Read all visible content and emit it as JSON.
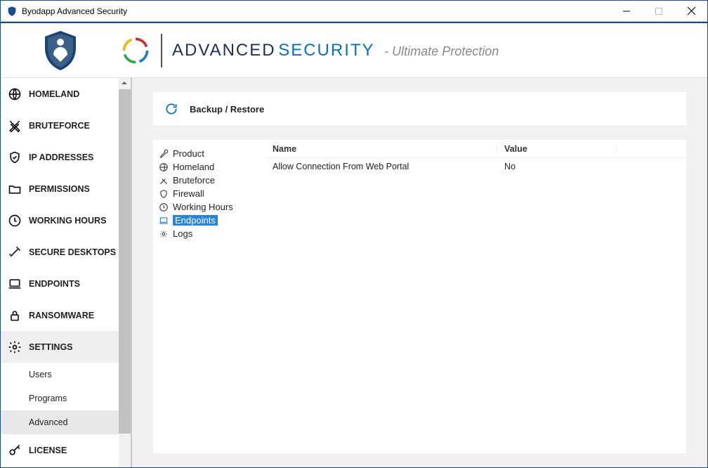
{
  "window": {
    "title": "Byodapp Advanced Security"
  },
  "header": {
    "brand_a": "ADVANCED",
    "brand_b": "SECURITY",
    "subtitle": "- Ultimate Protection"
  },
  "sidebar": {
    "items": [
      {
        "label": "HOMELAND",
        "icon": "globe",
        "selected": false
      },
      {
        "label": "BRUTEFORCE",
        "icon": "swords",
        "selected": false
      },
      {
        "label": "IP ADDRESSES",
        "icon": "shield-ip",
        "selected": false
      },
      {
        "label": "PERMISSIONS",
        "icon": "folder",
        "selected": false
      },
      {
        "label": "WORKING HOURS",
        "icon": "clock",
        "selected": false
      },
      {
        "label": "SECURE DESKTOPS",
        "icon": "wand",
        "selected": false
      },
      {
        "label": "ENDPOINTS",
        "icon": "laptop",
        "selected": false
      },
      {
        "label": "RANSOMWARE",
        "icon": "lock",
        "selected": false
      },
      {
        "label": "SETTINGS",
        "icon": "gear",
        "selected": true
      },
      {
        "label": "LICENSE",
        "icon": "key",
        "selected": false
      }
    ],
    "settings_sub": [
      {
        "label": "Users",
        "selected": false
      },
      {
        "label": "Programs",
        "selected": false
      },
      {
        "label": "Advanced",
        "selected": true
      }
    ]
  },
  "toolbar": {
    "backup_restore": "Backup / Restore"
  },
  "tree": {
    "items": [
      {
        "label": "Product",
        "icon": "wrench",
        "selected": false
      },
      {
        "label": "Homeland",
        "icon": "globe",
        "selected": false
      },
      {
        "label": "Bruteforce",
        "icon": "swords",
        "selected": false
      },
      {
        "label": "Firewall",
        "icon": "shield2",
        "selected": false
      },
      {
        "label": "Working Hours",
        "icon": "clock",
        "selected": false
      },
      {
        "label": "Endpoints",
        "icon": "laptop",
        "selected": true
      },
      {
        "label": "Logs",
        "icon": "gear",
        "selected": false
      }
    ]
  },
  "grid": {
    "columns": {
      "name": "Name",
      "value": "Value"
    },
    "rows": [
      {
        "name": "Allow Connection From Web Portal",
        "value": "No"
      }
    ]
  }
}
